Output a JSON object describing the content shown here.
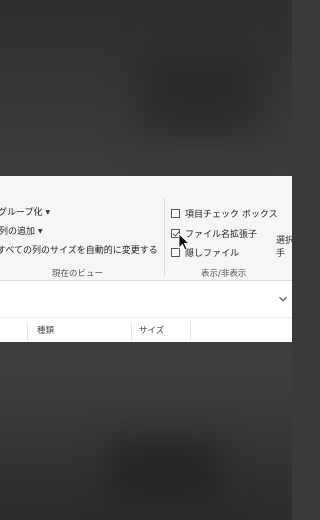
{
  "ribbon": {
    "layout_group": {
      "group_by": "グループ化",
      "add_columns": "列の追加",
      "size_all_columns": "すべての列のサイズを自動的に変更する",
      "label": "現在のビュー"
    },
    "show_hide_group": {
      "item_checkboxes": {
        "label": "項目チェック ボックス",
        "checked": false
      },
      "file_extensions": {
        "label": "ファイル名拡張子",
        "checked": true
      },
      "hidden_items": {
        "label": "隠しファイル",
        "checked": false
      },
      "label": "表示/非表示",
      "clipped_right_1": "選択",
      "clipped_right_2": "手"
    }
  },
  "columns": {
    "type": "種類",
    "size": "サイズ"
  },
  "icons": [
    "dropdown-arrow-icon",
    "checkbox-icon",
    "mouse-cursor-icon",
    "chevron-down-icon"
  ],
  "colors": {
    "ribbon_bg": "#f5f6f7",
    "check_accent": "#1a5fb4",
    "backdrop": "#3a3a3a"
  }
}
